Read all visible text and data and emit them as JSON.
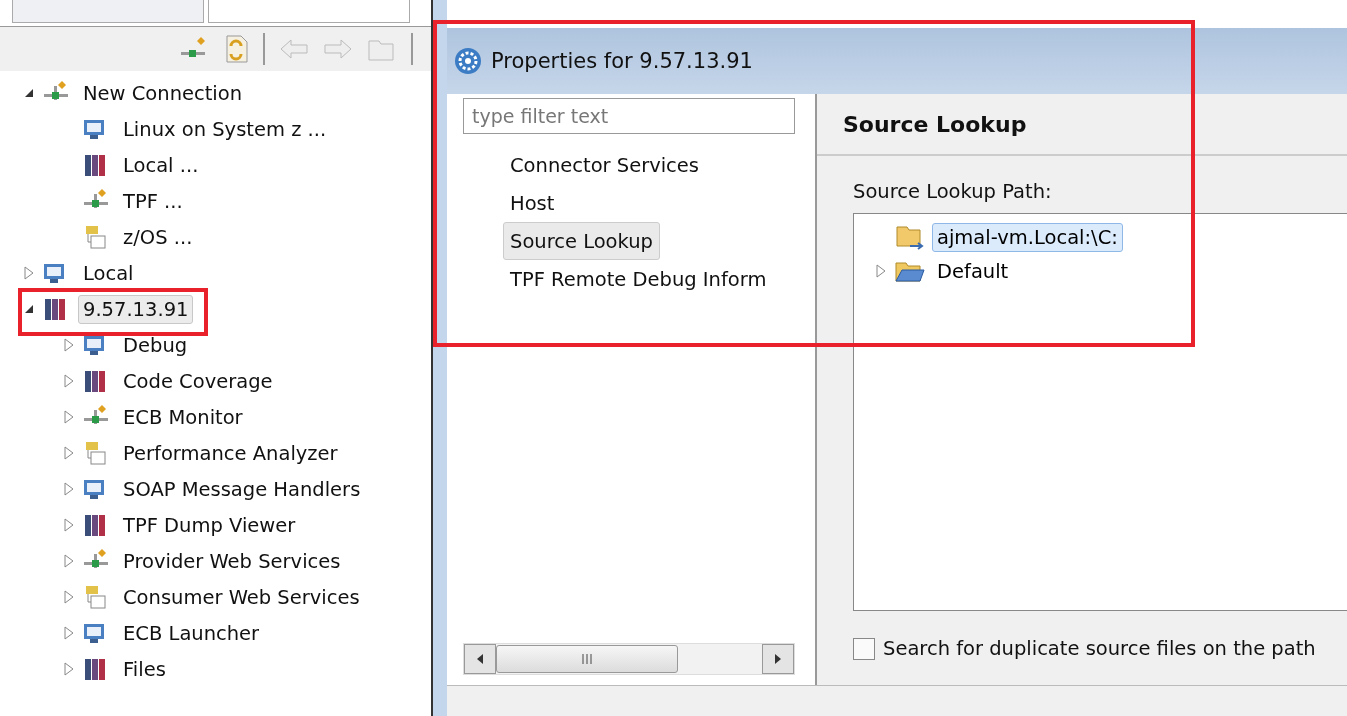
{
  "tree": [
    {
      "label": "New Connection",
      "expanded": true,
      "selected": false,
      "children": [
        {
          "label": "Linux on System z ...",
          "selected": false
        },
        {
          "label": "Local ...",
          "selected": false
        },
        {
          "label": "TPF ...",
          "selected": false
        },
        {
          "label": "z/OS ...",
          "selected": false
        }
      ]
    },
    {
      "label": "Local",
      "expanded": false,
      "selected": false
    },
    {
      "label": "9.57.13.91",
      "expanded": true,
      "selected": true,
      "children": [
        {
          "label": "Debug",
          "expanded": false,
          "selected": false
        },
        {
          "label": "Code Coverage",
          "expanded": false,
          "selected": false
        },
        {
          "label": "ECB Monitor",
          "expanded": false,
          "selected": false
        },
        {
          "label": "Performance Analyzer",
          "expanded": false,
          "selected": false
        },
        {
          "label": "SOAP Message Handlers",
          "expanded": false,
          "selected": false
        },
        {
          "label": "TPF Dump Viewer",
          "expanded": false,
          "selected": false
        },
        {
          "label": "Provider Web Services",
          "expanded": false,
          "selected": false
        },
        {
          "label": "Consumer Web Services",
          "expanded": false,
          "selected": false
        },
        {
          "label": "ECB Launcher",
          "expanded": false,
          "selected": false
        },
        {
          "label": "Files",
          "expanded": false,
          "selected": false
        }
      ]
    }
  ],
  "dialog": {
    "title": "Properties for 9.57.13.91",
    "filter": {
      "placeholder": "type filter text"
    },
    "pages": [
      {
        "label": "Connector Services",
        "selected": false
      },
      {
        "label": "Host",
        "selected": false
      },
      {
        "label": "Source Lookup",
        "selected": true
      },
      {
        "label": "TPF Remote Debug Inform",
        "selected": false
      }
    ],
    "page_title": "Source Lookup",
    "path_label": "Source Lookup Path:",
    "path_tree": [
      {
        "label": "ajmal-vm.Local:\\C:",
        "selected": true
      },
      {
        "label": "Default",
        "expanded": false,
        "selected": false
      }
    ],
    "duplicate_checkbox": {
      "label": "Search for duplicate source files on the path",
      "checked": false
    }
  }
}
